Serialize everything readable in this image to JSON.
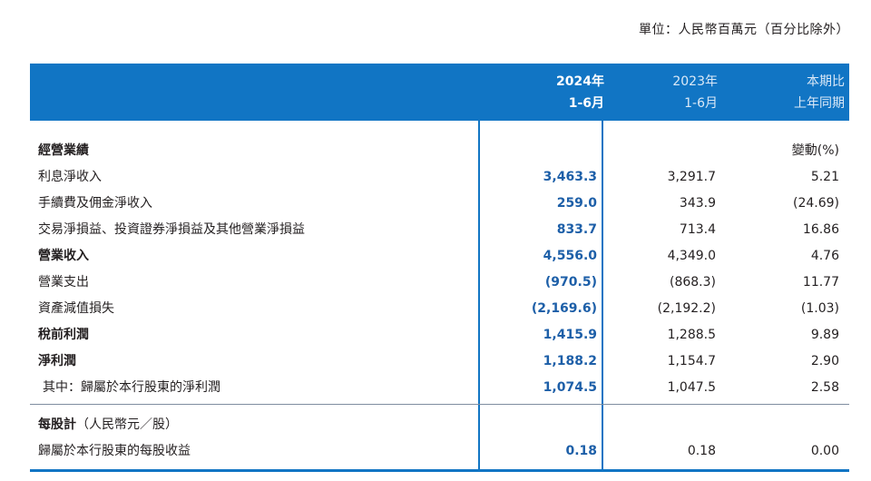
{
  "unit_note": "單位：人民幣百萬元（百分比除外）",
  "header": {
    "col1_line1": "2024年",
    "col1_line2": "1-6月",
    "col2_line1": "2023年",
    "col2_line2": "1-6月",
    "col3_line1": "本期比",
    "col3_line2": "上年同期"
  },
  "section1": {
    "title": "經營業績",
    "change_header": "變動(%)",
    "rows": [
      {
        "label": "利息淨收入",
        "v2024": "3,463.3",
        "v2023": "3,291.7",
        "change": "5.21",
        "bold": false
      },
      {
        "label": "手續費及佣金淨收入",
        "v2024": "259.0",
        "v2023": "343.9",
        "change": "(24.69)",
        "bold": false
      },
      {
        "label": "交易淨損益、投資證券淨損益及其他營業淨損益",
        "v2024": "833.7",
        "v2023": "713.4",
        "change": "16.86",
        "bold": false
      },
      {
        "label": "營業收入",
        "v2024": "4,556.0",
        "v2023": "4,349.0",
        "change": "4.76",
        "bold": true
      },
      {
        "label": "營業支出",
        "v2024": "(970.5)",
        "v2023": "(868.3)",
        "change": "11.77",
        "bold": false
      },
      {
        "label": "資產減值損失",
        "v2024": "(2,169.6)",
        "v2023": "(2,192.2)",
        "change": "(1.03)",
        "bold": false
      },
      {
        "label": "稅前利潤",
        "v2024": "1,415.9",
        "v2023": "1,288.5",
        "change": "9.89",
        "bold": true
      },
      {
        "label": "淨利潤",
        "v2024": "1,188.2",
        "v2023": "1,154.7",
        "change": "2.90",
        "bold": true
      },
      {
        "label": "其中：歸屬於本行股東的淨利潤",
        "v2024": "1,074.5",
        "v2023": "1,047.5",
        "change": "2.58",
        "bold": false
      }
    ]
  },
  "section2": {
    "title_bold": "每股計",
    "title_normal": "（人民幣元／股）",
    "rows": [
      {
        "label": "歸屬於本行股東的每股收益",
        "v2024": "0.18",
        "v2023": "0.18",
        "change": "0.00"
      }
    ]
  }
}
